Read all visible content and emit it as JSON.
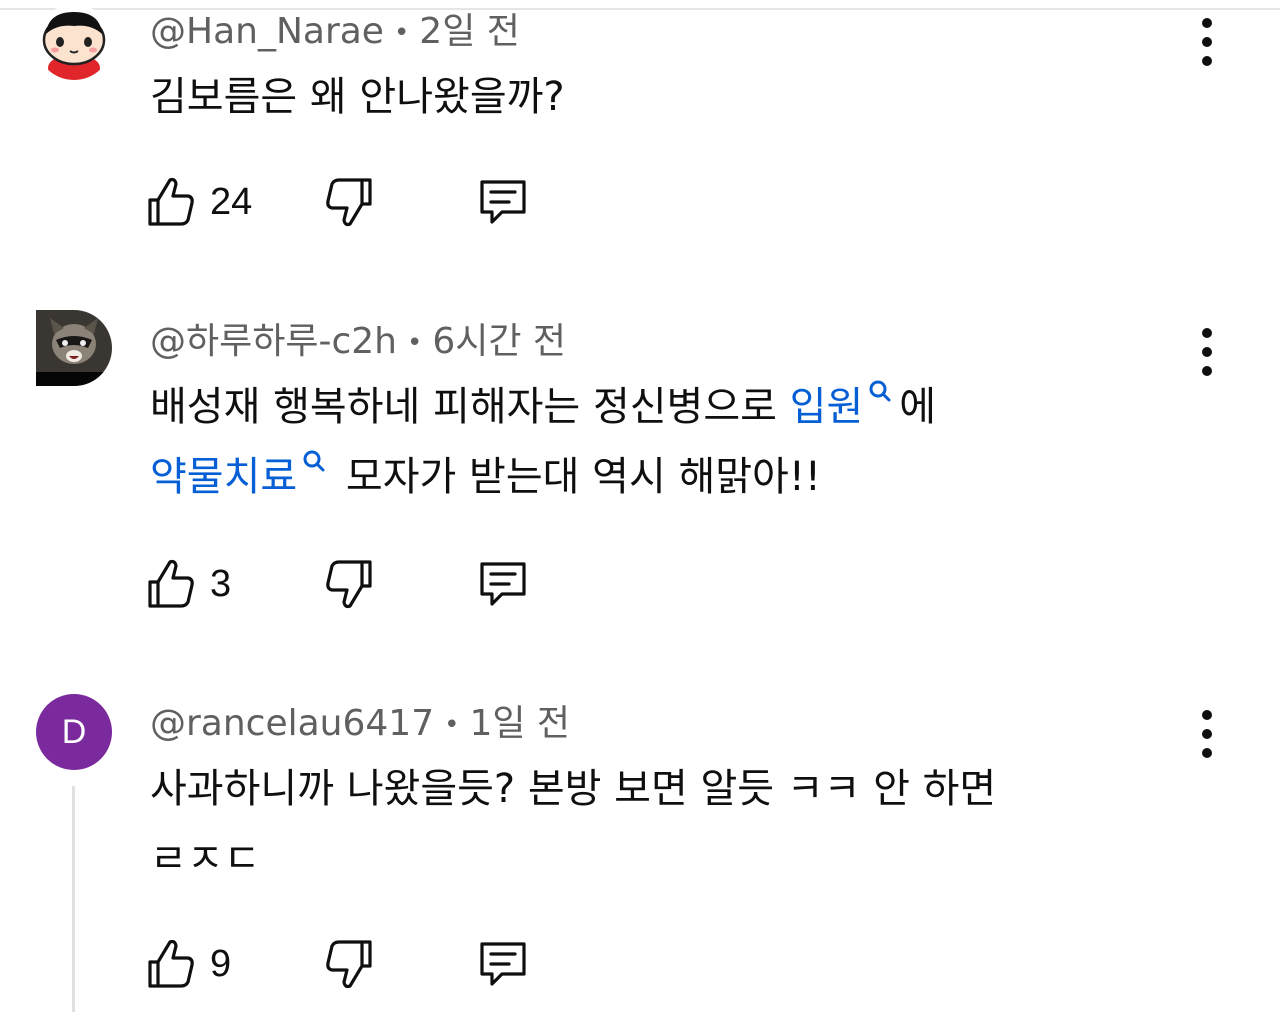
{
  "comments": [
    {
      "author": "@Han_Narae",
      "separator": "•",
      "time": "2일 전",
      "text_line1": "김보름은 왜 안나왔을까?",
      "likes": "24"
    },
    {
      "author": "@하루하루-c2h",
      "separator": "•",
      "time": "6시간 전",
      "text_a": "배성재 행복하네 피해자는 정신병으로 ",
      "link1": "입원",
      "text_b": "에",
      "link2": "약물치료",
      "text_c": " 모자가 받는대 역시 해맑아!!",
      "likes": "3"
    },
    {
      "author": "@rancelau6417",
      "separator": "•",
      "time": "1일 전",
      "avatar_letter": "D",
      "text_line1": "사과하니까 나왔을듯? 본방 보면 알듯 ㅋㅋ 안 하면",
      "text_line2": "ㄹㅈㄷ",
      "likes": "9"
    }
  ],
  "colors": {
    "link": "#065fd4",
    "meta": "#606060",
    "avatar_letter_bg": "#7b2a9e"
  },
  "icons": [
    "thumbs-up-icon",
    "thumbs-down-icon",
    "reply-icon",
    "more-vert-icon",
    "search-icon"
  ]
}
